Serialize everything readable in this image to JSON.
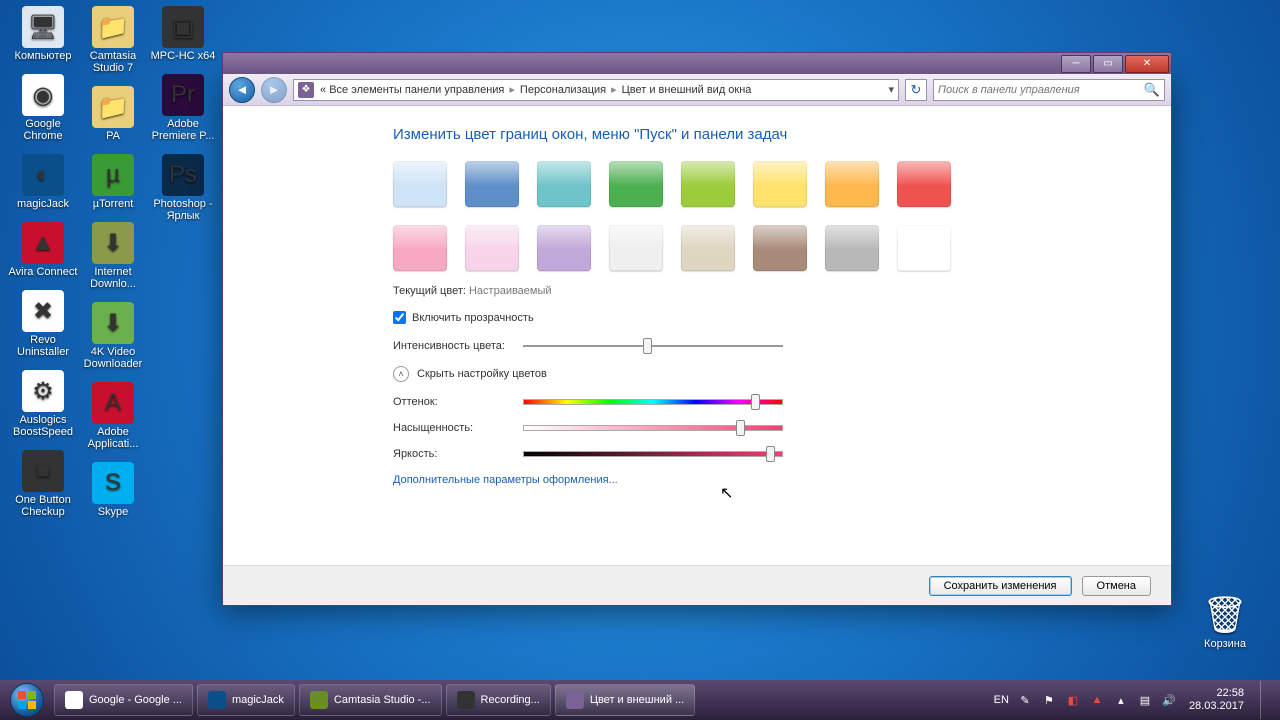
{
  "desktop_icons": {
    "col": [
      {
        "label": "Компьютер",
        "bg": "#dfe8f0",
        "glyph": "🖥"
      },
      {
        "label": "Google Chrome",
        "bg": "#fff",
        "glyph": "◉"
      },
      {
        "label": "magicJack",
        "bg": "#0b4f8a",
        "glyph": "◐"
      },
      {
        "label": "Avira Connect",
        "bg": "#c8102e",
        "glyph": "▲"
      },
      {
        "label": "Revo Uninstaller",
        "bg": "#fff",
        "glyph": "✖"
      },
      {
        "label": "Auslogics BoostSpeed",
        "bg": "#fff",
        "glyph": "⚙"
      },
      {
        "label": "One Button Checkup",
        "bg": "#333",
        "glyph": "■"
      },
      {
        "label": "Camtasia Studio 7",
        "bg": "#e8d07a",
        "glyph": "📁"
      },
      {
        "label": "PA",
        "bg": "#e8d07a",
        "glyph": "📁"
      },
      {
        "label": "µTorrent",
        "bg": "#3a9b35",
        "glyph": "µ"
      },
      {
        "label": "Internet Downlo...",
        "bg": "#8a9a4a",
        "glyph": "⬇"
      },
      {
        "label": "4K Video Downloader",
        "bg": "#6ab04c",
        "glyph": "⬇"
      },
      {
        "label": "Adobe Applicati...",
        "bg": "#c8102e",
        "glyph": "A"
      },
      {
        "label": "Skype",
        "bg": "#00aff0",
        "glyph": "S"
      },
      {
        "label": "MPC-HC x64",
        "bg": "#333",
        "glyph": "▣"
      },
      {
        "label": "Adobe Premiere P...",
        "bg": "#2a0a3a",
        "glyph": "Pr"
      },
      {
        "label": "Photoshop - Ярлык",
        "bg": "#0a2a4a",
        "glyph": "Ps"
      }
    ],
    "recycle": {
      "label": "Корзина",
      "glyph": "🗑"
    }
  },
  "window": {
    "breadcrumb": {
      "pre": "«",
      "root": "Все элементы панели управления",
      "mid": "Персонализация",
      "leaf": "Цвет и внешний вид окна"
    },
    "search_placeholder": "Поиск в панели управления",
    "heading": "Изменить цвет границ окон, меню \"Пуск\" и панели задач",
    "swatch_colors": [
      "#cfe4f7",
      "#5e8fc9",
      "#6fc4c9",
      "#4caf50",
      "#9ccc3c",
      "#ffe26b",
      "#ffb84d",
      "#ef5350",
      "#f7a8c2",
      "#f7d4ea",
      "#c0a8d8",
      "#efefef",
      "#ded6c0",
      "#a88a78",
      "#b8b8b8",
      "#ffffff"
    ],
    "current_color_label": "Текущий цвет:",
    "current_color_value": "Настраиваемый",
    "transparency_label": "Включить прозрачность",
    "transparency_checked": true,
    "intensity_label": "Интенсивность цвета:",
    "expander_label": "Скрыть настройку цветов",
    "hue_label": "Оттенок:",
    "sat_label": "Насыщенность:",
    "bri_label": "Яркость:",
    "sliders": {
      "intensity": 48,
      "hue": 91,
      "sat": 85,
      "bri": 97
    },
    "advanced_link": "Дополнительные параметры оформления...",
    "save_btn": "Сохранить изменения",
    "cancel_btn": "Отмена"
  },
  "taskbar": {
    "items": [
      {
        "label": "Google - Google ...",
        "icon_bg": "#fff",
        "active": false
      },
      {
        "label": "magicJack",
        "icon_bg": "#0b4f8a",
        "active": false
      },
      {
        "label": "Camtasia Studio -...",
        "icon_bg": "#6b8e23",
        "active": false
      },
      {
        "label": "Recording...",
        "icon_bg": "#333",
        "active": false
      },
      {
        "label": "Цвет и внешний ...",
        "icon_bg": "#7a6394",
        "active": true
      }
    ],
    "lang": "EN",
    "time": "22:58",
    "date": "28.03.2017"
  }
}
